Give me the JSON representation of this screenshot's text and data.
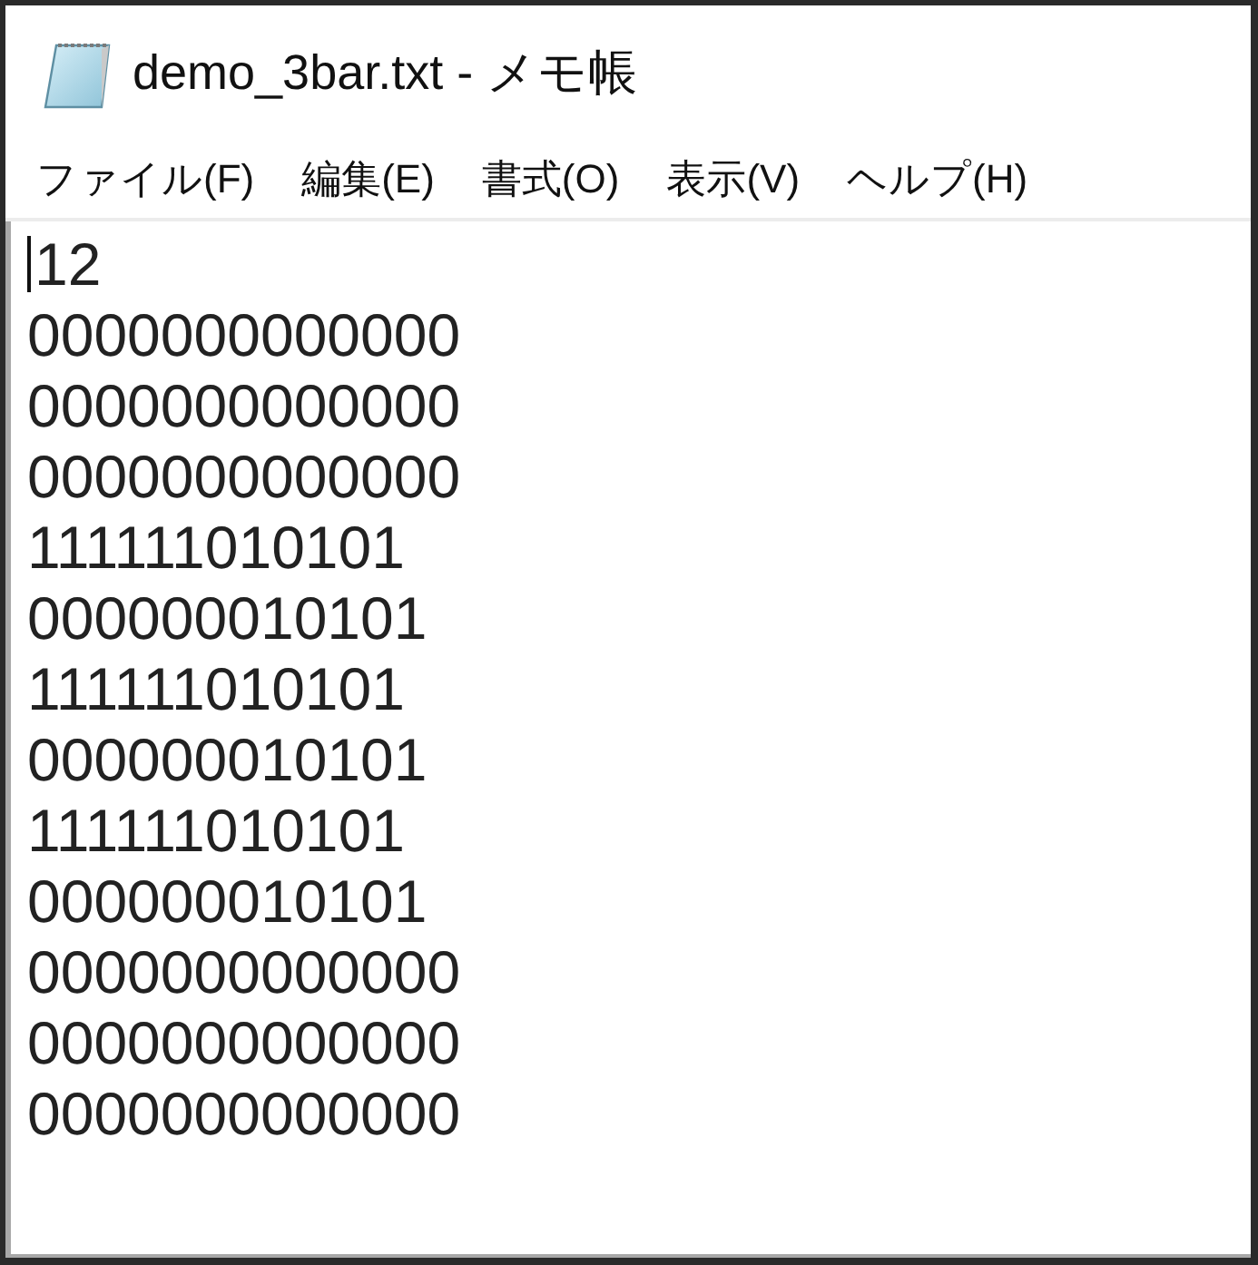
{
  "window": {
    "title": "demo_3bar.txt - メモ帳"
  },
  "menu": [
    {
      "label": "ファイル(F)"
    },
    {
      "label": "編集(E)"
    },
    {
      "label": "書式(O)"
    },
    {
      "label": "表示(V)"
    },
    {
      "label": "ヘルプ(H)"
    }
  ],
  "lines": [
    {
      "text": "12",
      "caret": true
    },
    {
      "text": "0000000000000",
      "caret": false
    },
    {
      "text": "0000000000000",
      "caret": false
    },
    {
      "text": "0000000000000",
      "caret": false
    },
    {
      "text": "111111010101",
      "caret": false
    },
    {
      "text": "000000010101",
      "caret": false
    },
    {
      "text": "111111010101",
      "caret": false
    },
    {
      "text": "000000010101",
      "caret": false
    },
    {
      "text": "111111010101",
      "caret": false
    },
    {
      "text": "000000010101",
      "caret": false
    },
    {
      "text": "0000000000000",
      "caret": false
    },
    {
      "text": "0000000000000",
      "caret": false
    },
    {
      "text": "0000000000000",
      "caret": false
    }
  ]
}
